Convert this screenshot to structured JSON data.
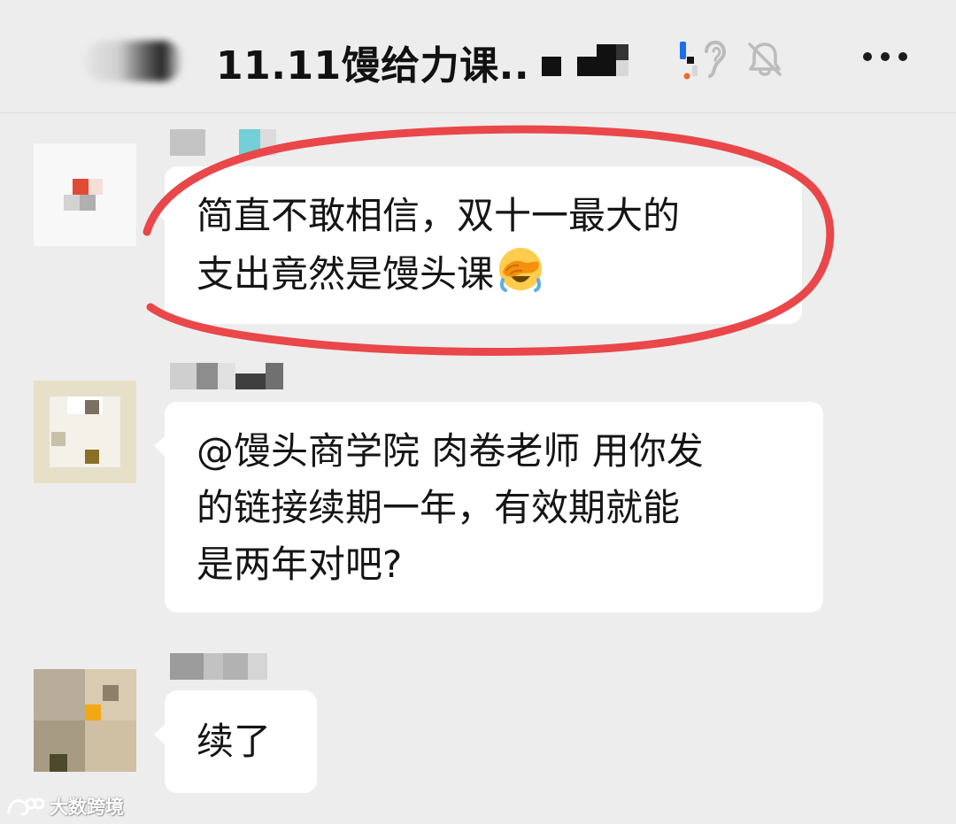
{
  "header": {
    "title": "11.11馒给力课..",
    "icons": [
      "back-button-blurred",
      "ear-icon",
      "mute-icon",
      "more-icon"
    ]
  },
  "messages": [
    {
      "sender": "redacted",
      "lines": [
        "简直不敢相信，双十一最大的",
        "支出竟然是馒头课"
      ],
      "emoji": "face-with-hand-over-eyes",
      "highlighted": true
    },
    {
      "sender": "redacted",
      "lines": [
        "@馒头商学院 肉卷老师 用你发",
        "的链接续期一年，有效期就能",
        "是两年对吧?"
      ]
    },
    {
      "sender": "redacted",
      "lines": [
        "续了"
      ]
    }
  ],
  "watermark": {
    "text": "大数跨境"
  },
  "colors": {
    "background": "#ededed",
    "bubble": "#ffffff",
    "highlight": "#e94749",
    "text": "#151515"
  }
}
